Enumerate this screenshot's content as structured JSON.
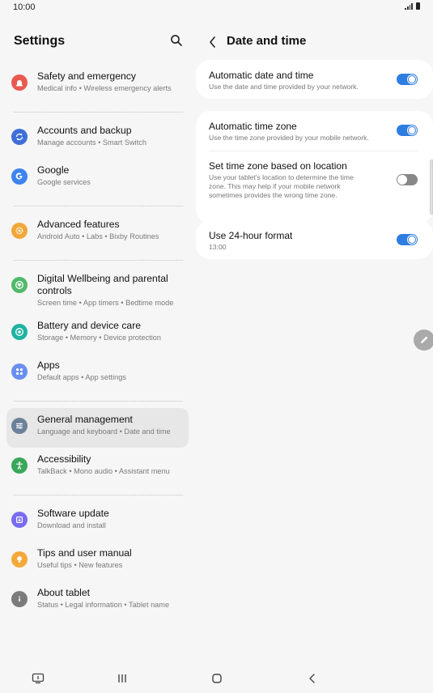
{
  "status": {
    "time": "10:00"
  },
  "settings": {
    "title": "Settings",
    "groups": [
      [
        {
          "title": "Safety and emergency",
          "sub": "Medical info  •  Wireless emergency alerts",
          "color": "#e8594f",
          "icon": "siren-icon"
        }
      ],
      [
        {
          "title": "Accounts and backup",
          "sub": "Manage accounts  •  Smart Switch",
          "color": "#3f6fd8",
          "icon": "sync-icon"
        },
        {
          "title": "Google",
          "sub": "Google services",
          "color": "#3e84f0",
          "icon": "google-icon"
        }
      ],
      [
        {
          "title": "Advanced features",
          "sub": "Android Auto  •  Labs  •  Bixby Routines",
          "color": "#f2a73a",
          "icon": "gear-plus-icon"
        }
      ],
      [
        {
          "title": "Digital Wellbeing and parental controls",
          "sub": "Screen time  •  App timers  •  Bedtime mode",
          "color": "#52b96a",
          "icon": "heart-circle-icon"
        },
        {
          "title": "Battery and device care",
          "sub": "Storage  •  Memory  •  Device protection",
          "color": "#1fb3a1",
          "icon": "device-care-icon"
        },
        {
          "title": "Apps",
          "sub": "Default apps  •  App settings",
          "color": "#6b8ff0",
          "icon": "apps-grid-icon"
        }
      ],
      [
        {
          "title": "General management",
          "sub": "Language and keyboard  •  Date and time",
          "color": "#6b8199",
          "icon": "sliders-icon",
          "active": true
        },
        {
          "title": "Accessibility",
          "sub": "TalkBack  •  Mono audio  •  Assistant menu",
          "color": "#3aa85a",
          "icon": "accessibility-icon"
        }
      ],
      [
        {
          "title": "Software update",
          "sub": "Download and install",
          "color": "#7a6cf0",
          "icon": "update-icon"
        },
        {
          "title": "Tips and user manual",
          "sub": "Useful tips  •  New features",
          "color": "#f4a93b",
          "icon": "lightbulb-icon"
        },
        {
          "title": "About tablet",
          "sub": "Status  •  Legal information  •  Tablet name",
          "color": "#7c7c7c",
          "icon": "info-icon"
        }
      ]
    ]
  },
  "date_time": {
    "title": "Date and time",
    "auto_date": {
      "title": "Automatic date and time",
      "sub": "Use the date and time provided by your network.",
      "on": true
    },
    "auto_zone": {
      "title": "Automatic time zone",
      "sub": "Use the time zone provided by your mobile network.",
      "on": true
    },
    "zone_location": {
      "title": "Set time zone based on location",
      "sub": "Use your tablet's location to determine the time zone. This may help if your mobile network sometimes provides the wrong time zone.",
      "on": false
    },
    "format24": {
      "title": "Use 24-hour format",
      "sub": "13:00",
      "on": true
    }
  }
}
